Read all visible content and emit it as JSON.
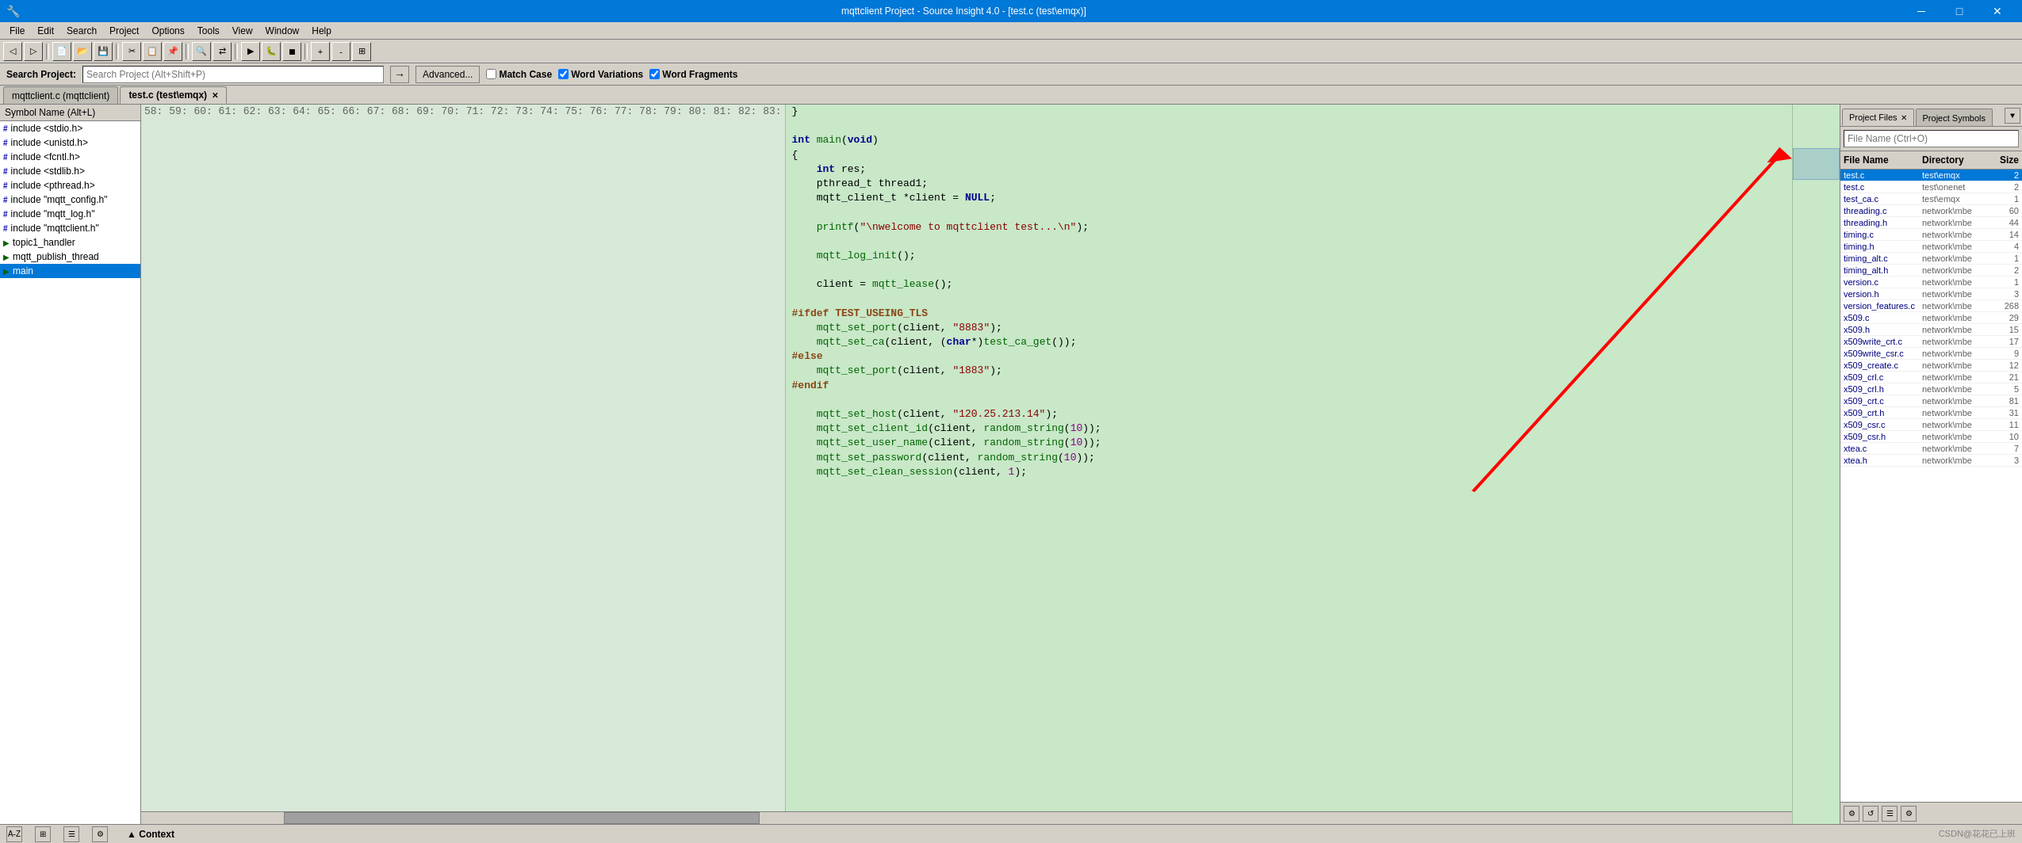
{
  "titlebar": {
    "title": "mqttclient Project - Source Insight 4.0 - [test.c (test\\emqx)]",
    "min_label": "─",
    "max_label": "□",
    "close_label": "✕"
  },
  "menubar": {
    "items": [
      "File",
      "Edit",
      "Search",
      "Project",
      "Options",
      "Tools",
      "View",
      "Window",
      "Help"
    ]
  },
  "searchbar": {
    "label": "Search Project:",
    "placeholder": "Search Project (Alt+Shift+P)",
    "advanced_label": "Advanced...",
    "match_case_label": "Match Case",
    "word_variations_label": "Word Variations",
    "word_fragments_label": "Word Fragments"
  },
  "tabs": [
    {
      "label": "mqttclient.c (mqttclient)",
      "active": false,
      "closable": false
    },
    {
      "label": "test.c (test\\emqx)",
      "active": true,
      "closable": true
    }
  ],
  "symbol_panel": {
    "header": "Symbol Name (Alt+L)",
    "items": [
      {
        "icon": "#",
        "label": "include <stdio.h>"
      },
      {
        "icon": "#",
        "label": "include <unistd.h>"
      },
      {
        "icon": "#",
        "label": "include <fcntl.h>"
      },
      {
        "icon": "#",
        "label": "include <stdlib.h>"
      },
      {
        "icon": "#",
        "label": "include <pthread.h>"
      },
      {
        "icon": "#",
        "label": "include \"mqtt_config.h\""
      },
      {
        "icon": "#",
        "label": "include \"mqtt_log.h\""
      },
      {
        "icon": "#",
        "label": "include \"mqttclient.h\""
      },
      {
        "icon": "f",
        "label": "topic1_handler"
      },
      {
        "icon": "f",
        "label": "mqtt_publish_thread"
      },
      {
        "icon": "f",
        "label": "main",
        "selected": true
      }
    ]
  },
  "code": {
    "lines": [
      {
        "num": "58:",
        "content": "}",
        "type": "plain"
      },
      {
        "num": "59:",
        "content": "",
        "type": "plain"
      },
      {
        "num": "60:",
        "content": "int main(void)",
        "type": "fn_decl"
      },
      {
        "num": "61:",
        "content": "{",
        "type": "plain"
      },
      {
        "num": "62:",
        "content": "    int res;",
        "type": "plain"
      },
      {
        "num": "63:",
        "content": "    pthread_t thread1;",
        "type": "plain"
      },
      {
        "num": "64:",
        "content": "    mqtt_client_t *client = NULL;",
        "type": "plain"
      },
      {
        "num": "65:",
        "content": "",
        "type": "plain"
      },
      {
        "num": "66:",
        "content": "    printf(\"\\nwelcome to mqttclient test...\\n\");",
        "type": "plain"
      },
      {
        "num": "67:",
        "content": "",
        "type": "plain"
      },
      {
        "num": "68:",
        "content": "    mqtt_log_init();",
        "type": "plain"
      },
      {
        "num": "69:",
        "content": "",
        "type": "plain"
      },
      {
        "num": "70:",
        "content": "    client = mqtt_lease();",
        "type": "plain"
      },
      {
        "num": "71:",
        "content": "",
        "type": "plain"
      },
      {
        "num": "72:",
        "content": "#ifdef TEST_USEING_TLS",
        "type": "preprocessor"
      },
      {
        "num": "73:",
        "content": "    mqtt_set_port(client, \"8883\");",
        "type": "plain"
      },
      {
        "num": "74:",
        "content": "    mqtt_set_ca(client, (char*)test_ca_get());",
        "type": "plain"
      },
      {
        "num": "75:",
        "content": "#else",
        "type": "preprocessor"
      },
      {
        "num": "76:",
        "content": "    mqtt_set_port(client, \"1883\");",
        "type": "plain"
      },
      {
        "num": "77:",
        "content": "#endif",
        "type": "preprocessor"
      },
      {
        "num": "78:",
        "content": "",
        "type": "plain"
      },
      {
        "num": "79:",
        "content": "    mqtt_set_host(client, \"120.25.213.14\");",
        "type": "plain"
      },
      {
        "num": "80:",
        "content": "    mqtt_set_client_id(client, random_string(10));",
        "type": "plain"
      },
      {
        "num": "81:",
        "content": "    mqtt_set_user_name(client, random_string(10));",
        "type": "plain"
      },
      {
        "num": "82:",
        "content": "    mqtt_set_password(client, random_string(10));",
        "type": "plain"
      },
      {
        "num": "83:",
        "content": "    mqtt_set_clean_session(client, 1);",
        "type": "plain"
      }
    ]
  },
  "right_panel": {
    "tabs": [
      {
        "label": "Project Files",
        "active": true,
        "closable": true
      },
      {
        "label": "Project Symbols",
        "active": false,
        "closable": false
      }
    ],
    "search_placeholder": "File Name (Ctrl+O)",
    "columns": [
      "File Name",
      "Directory",
      "Size"
    ],
    "files": [
      {
        "name": "test.c",
        "dir": "test\\emqx",
        "size": "2",
        "selected": true
      },
      {
        "name": "test.c",
        "dir": "test\\onenet",
        "size": "2"
      },
      {
        "name": "test_ca.c",
        "dir": "test\\emqx",
        "size": "1"
      },
      {
        "name": "threading.c",
        "dir": "network\\mbe",
        "size": "60"
      },
      {
        "name": "threading.h",
        "dir": "network\\mbe",
        "size": "44"
      },
      {
        "name": "timing.c",
        "dir": "network\\mbe",
        "size": "14"
      },
      {
        "name": "timing.h",
        "dir": "network\\mbe",
        "size": "4"
      },
      {
        "name": "timing_alt.c",
        "dir": "network\\mbe",
        "size": "1"
      },
      {
        "name": "timing_alt.h",
        "dir": "network\\mbe",
        "size": "2"
      },
      {
        "name": "version.c",
        "dir": "network\\mbe",
        "size": "1"
      },
      {
        "name": "version.h",
        "dir": "network\\mbe",
        "size": "3"
      },
      {
        "name": "version_features.c",
        "dir": "network\\mbe",
        "size": "268"
      },
      {
        "name": "x509.c",
        "dir": "network\\mbe",
        "size": "29"
      },
      {
        "name": "x509.h",
        "dir": "network\\mbe",
        "size": "15"
      },
      {
        "name": "x509write_crt.c",
        "dir": "network\\mbe",
        "size": "17"
      },
      {
        "name": "x509write_csr.c",
        "dir": "network\\mbe",
        "size": "9"
      },
      {
        "name": "x509_create.c",
        "dir": "network\\mbe",
        "size": "12"
      },
      {
        "name": "x509_crl.c",
        "dir": "network\\mbe",
        "size": "21"
      },
      {
        "name": "x509_crl.h",
        "dir": "network\\mbe",
        "size": "5"
      },
      {
        "name": "x509_crt.c",
        "dir": "network\\mbe",
        "size": "81"
      },
      {
        "name": "x509_crt.h",
        "dir": "network\\mbe",
        "size": "31"
      },
      {
        "name": "x509_csr.c",
        "dir": "network\\mbe",
        "size": "11"
      },
      {
        "name": "x509_csr.h",
        "dir": "network\\mbe",
        "size": "10"
      },
      {
        "name": "xtea.c",
        "dir": "network\\mbe",
        "size": "7"
      },
      {
        "name": "xtea.h",
        "dir": "network\\mbe",
        "size": "3"
      }
    ]
  },
  "bottombar": {
    "context_label": "▲ Context"
  },
  "watermark": "CSDN@花花已上班"
}
